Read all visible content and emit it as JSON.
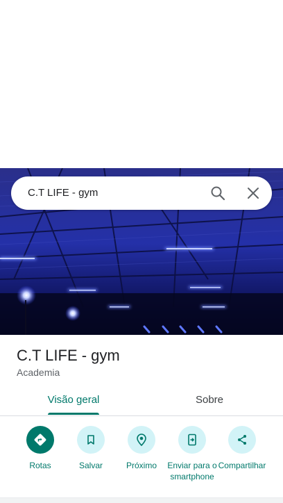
{
  "search": {
    "query": "C.T LIFE - gym"
  },
  "place": {
    "name": "C.T LIFE - gym",
    "category": "Academia"
  },
  "tabs": [
    {
      "label": "Visão geral",
      "active": true
    },
    {
      "label": "Sobre",
      "active": false
    }
  ],
  "actions": [
    {
      "label": "Rotas",
      "icon": "directions-icon"
    },
    {
      "label": "Salvar",
      "icon": "bookmark-icon"
    },
    {
      "label": "Próximo",
      "icon": "nearby-icon"
    },
    {
      "label": "Enviar para o smartphone",
      "icon": "send-to-phone-icon"
    },
    {
      "label": "Compartilhar",
      "icon": "share-icon"
    }
  ],
  "colors": {
    "accent": "#00796b",
    "action_bg": "#d2f3f7",
    "neon": "#3d5bff"
  }
}
